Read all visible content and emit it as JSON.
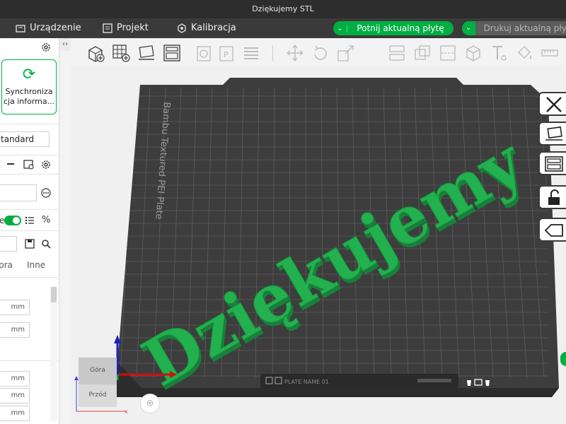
{
  "window": {
    "title": "Dziękujemy STL"
  },
  "menu": {
    "device": "Urządzenie",
    "project": "Projekt",
    "calibration": "Kalibracja"
  },
  "actions": {
    "slice_label": "Potnij aktualną płytę",
    "print_label": "Drukuj aktualną płytę"
  },
  "sidebar": {
    "sync_label_line1": "Synchroniza",
    "sync_label_line2": "cja informa...",
    "process_preset": "tandard",
    "toggle_label": "e",
    "tabs": [
      "pra",
      "Inne"
    ],
    "unit": "mm",
    "unit_rows": 6
  },
  "plate": {
    "name": "Bambu Textured PEI Plate",
    "model_text": "Dziękujemy",
    "bottom_bar_text": "PLATE NAME 01"
  },
  "view_cube": {
    "top": "Góra",
    "front": "Przód"
  },
  "colors": {
    "accent": "#00ae42",
    "plate": "#3c3c3c",
    "model": "#1fa84a"
  }
}
